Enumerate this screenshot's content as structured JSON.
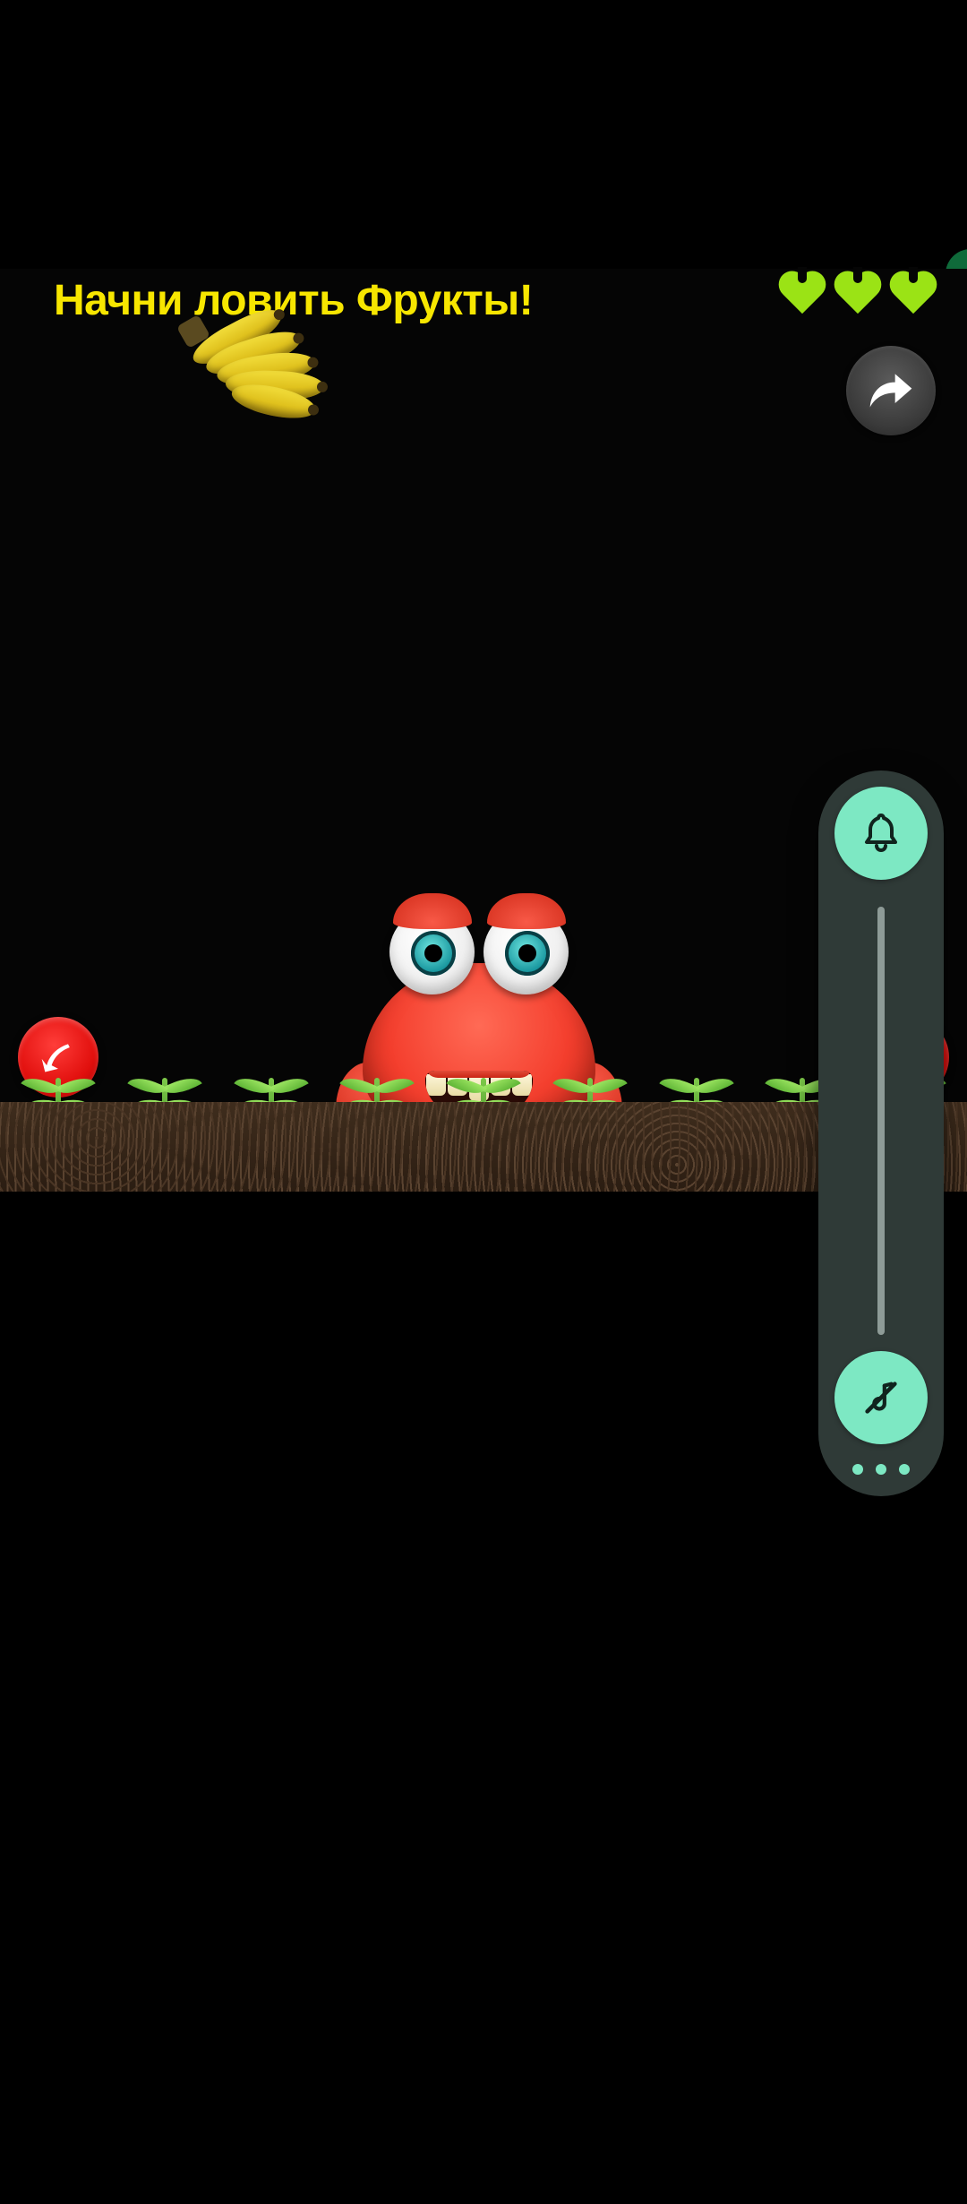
{
  "game": {
    "title": "Начни ловить Фрукты!",
    "lives": 3,
    "falling_fruit": "bananas",
    "character": "red-monster"
  },
  "buttons": {
    "share": "share",
    "move_left": "move-left",
    "move_right": "move-right"
  },
  "volume_overlay": {
    "top_button": "ring-mode",
    "bottom_button": "mute-media",
    "slider_value_percent": 0,
    "more": "more-options"
  },
  "colors": {
    "title": "#f7e600",
    "heart": "#9be315",
    "move_button": "#e10f0d",
    "overlay_accent": "#7de8c3",
    "overlay_bg": "#2f3a37"
  }
}
